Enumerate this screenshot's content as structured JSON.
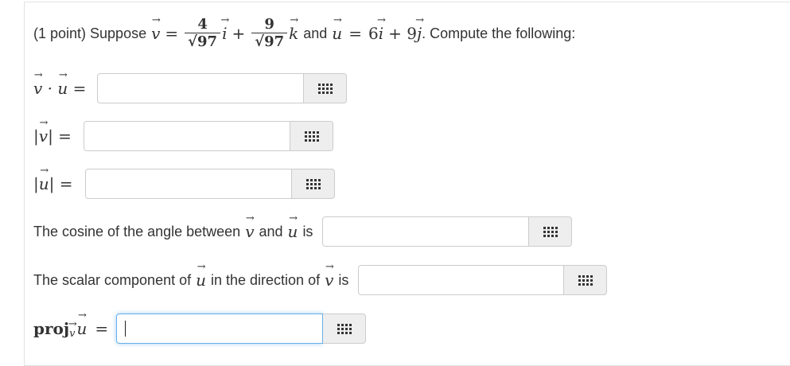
{
  "problem": {
    "points_label": "(1 point) Suppose",
    "v_num1": "4",
    "v_num2": "9",
    "radical": "√97",
    "and_word": "and",
    "u_expr": "6",
    "u_expr2": "+ 9",
    "compute": ". Compute the following:"
  },
  "questions": {
    "cosine_text1": "The cosine of the angle between",
    "cosine_and": "and",
    "cosine_is": "is",
    "scalar_text1": "The scalar component of",
    "scalar_text2": "in the direction of",
    "scalar_is": "is",
    "proj_word": "proj"
  },
  "answers": {
    "dot_value": "",
    "v_mag_value": "",
    "u_mag_value": "",
    "cosine_value": "",
    "scalar_value": "",
    "proj_value": ""
  },
  "colors": {
    "focus_border": "#66afe9",
    "addon_bg": "#eeeeee",
    "text": "#333333"
  },
  "icons": {
    "equation_editor": "grid-icon"
  }
}
